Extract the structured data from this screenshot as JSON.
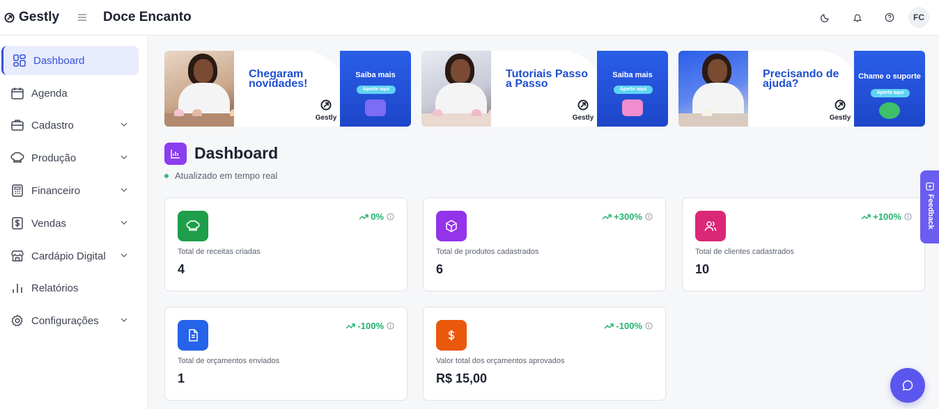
{
  "app": {
    "name": "Gestly",
    "company": "Doce Encanto",
    "user_initials": "FC"
  },
  "topbar": {
    "icons": [
      "moon-icon",
      "bell-icon",
      "help-icon"
    ]
  },
  "sidebar": {
    "items": [
      {
        "label": "Dashboard",
        "icon": "dashboard-icon",
        "active": true,
        "has_submenu": false
      },
      {
        "label": "Agenda",
        "icon": "calendar-icon",
        "has_submenu": false
      },
      {
        "label": "Cadastro",
        "icon": "briefcase-icon",
        "has_submenu": true
      },
      {
        "label": "Produção",
        "icon": "chef-hat-icon",
        "has_submenu": true
      },
      {
        "label": "Financeiro",
        "icon": "calculator-icon",
        "has_submenu": true
      },
      {
        "label": "Vendas",
        "icon": "dollar-icon",
        "has_submenu": true
      },
      {
        "label": "Cardápio Digital",
        "icon": "store-icon",
        "has_submenu": true
      },
      {
        "label": "Relatórios",
        "icon": "bar-chart-icon",
        "has_submenu": false
      },
      {
        "label": "Configurações",
        "icon": "gear-icon",
        "has_submenu": true
      }
    ]
  },
  "banners": [
    {
      "headline": "Chegaram novidades!",
      "cta": "Saiba mais",
      "pill": "Aperte aqui",
      "brand": "Gestly"
    },
    {
      "headline": "Tutoriais Passo a Passo",
      "cta": "Saiba mais",
      "pill": "Aperte aqui",
      "brand": "Gestly"
    },
    {
      "headline": "Precisando de ajuda?",
      "cta": "Chame o suporte",
      "pill": "Aperte aqui",
      "brand": "Gestly"
    }
  ],
  "dashboard": {
    "title": "Dashboard",
    "status": "Atualizado em tempo real",
    "cards": [
      {
        "label": "Total de receitas criadas",
        "value": "4",
        "trend": "0%",
        "icon": "chef-hat-icon",
        "color": "#1e9e4a"
      },
      {
        "label": "Total de produtos cadastrados",
        "value": "6",
        "trend": "+300%",
        "icon": "box-icon",
        "color": "#9333ea"
      },
      {
        "label": "Total de clientes cadastrados",
        "value": "10",
        "trend": "+100%",
        "icon": "users-icon",
        "color": "#db2777"
      },
      {
        "label": "Total de orçamentos enviados",
        "value": "1",
        "trend": "-100%",
        "icon": "document-icon",
        "color": "#2563eb"
      },
      {
        "label": "Valor total dos orçamentos aprovados",
        "value": "R$ 15,00",
        "trend": "-100%",
        "icon": "dollar-icon",
        "color": "#ea580c"
      }
    ]
  },
  "feedback": {
    "label": "Feedback"
  },
  "colors": {
    "accent": "#3853d8",
    "active_bg": "#e8ecfd",
    "trend_green": "#24b36b",
    "banner_blue": "#2a5ee8",
    "feedback": "#6a5df0",
    "chat": "#5b57ee"
  }
}
